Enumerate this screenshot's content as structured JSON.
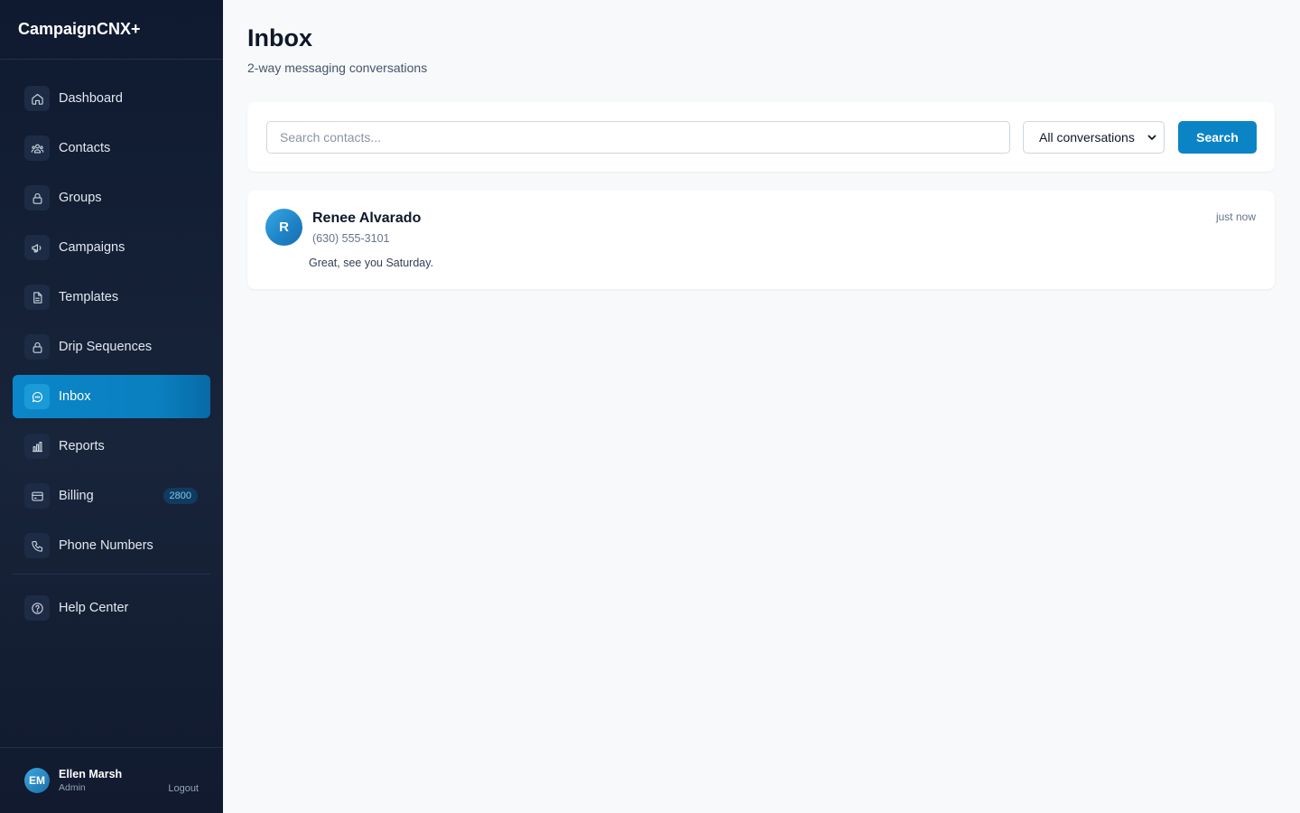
{
  "app": {
    "brand": "CampaignCNX+"
  },
  "sidebar": {
    "items": [
      {
        "label": "Dashboard",
        "icon": "home-icon"
      },
      {
        "label": "Contacts",
        "icon": "users-icon"
      },
      {
        "label": "Groups",
        "icon": "lock-icon"
      },
      {
        "label": "Campaigns",
        "icon": "megaphone-icon"
      },
      {
        "label": "Templates",
        "icon": "document-icon"
      },
      {
        "label": "Drip Sequences",
        "icon": "lock-icon"
      },
      {
        "label": "Inbox",
        "icon": "chat-icon",
        "active": true
      },
      {
        "label": "Reports",
        "icon": "bar-chart-icon"
      },
      {
        "label": "Billing",
        "icon": "credit-card-icon",
        "badge": "2800"
      },
      {
        "label": "Phone Numbers",
        "icon": "phone-icon"
      }
    ],
    "help": {
      "label": "Help Center",
      "icon": "help-icon"
    },
    "user": {
      "initials": "EM",
      "name": "Ellen Marsh",
      "role": "Admin",
      "logout": "Logout"
    }
  },
  "header": {
    "title": "Inbox",
    "subtitle": "2-way messaging conversations"
  },
  "search": {
    "placeholder": "Search contacts...",
    "value": "",
    "filter_selected": "All conversations",
    "button_label": "Search"
  },
  "conversations": [
    {
      "initial": "R",
      "name": "Renee Alvarado",
      "phone": "(630) 555-3101",
      "message": "Great, see you Saturday.",
      "time": "just now"
    }
  ],
  "colors": {
    "accent": "#0b84c6",
    "sidebar_bg": "#0f1a30",
    "page_bg": "#f7f9fb"
  }
}
